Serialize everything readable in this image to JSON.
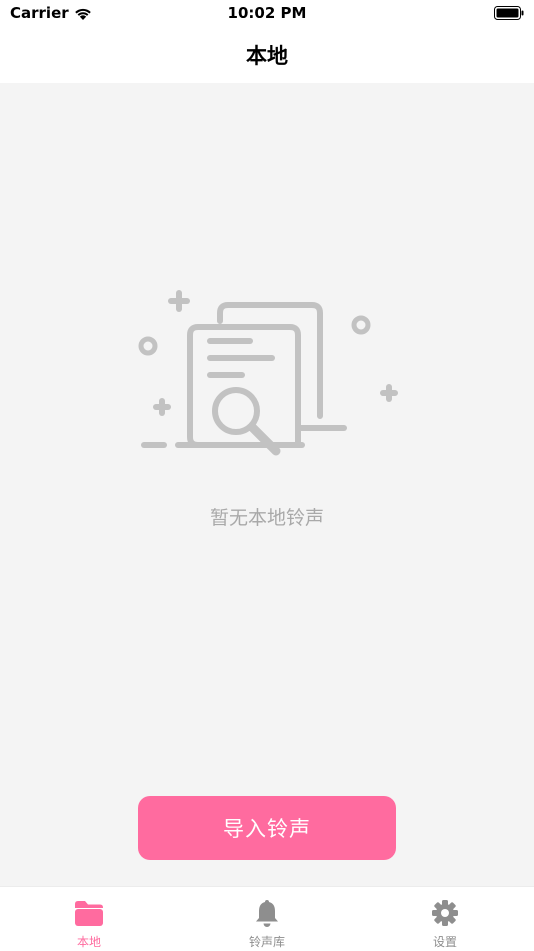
{
  "status_bar": {
    "carrier": "Carrier",
    "time": "10:02 PM"
  },
  "nav": {
    "title": "本地"
  },
  "empty_state": {
    "message": "暂无本地铃声",
    "icon": "document-search-icon"
  },
  "import_button": {
    "label": "导入铃声"
  },
  "tabs": [
    {
      "label": "本地",
      "icon": "folder-icon",
      "active": true
    },
    {
      "label": "铃声库",
      "icon": "bell-icon",
      "active": false
    },
    {
      "label": "设置",
      "icon": "gear-icon",
      "active": false
    }
  ],
  "colors": {
    "accent": "#ff6b9f",
    "background": "#f4f4f4",
    "illustration": "#c2c2c2",
    "inactive_tab": "#8e8e8e"
  }
}
